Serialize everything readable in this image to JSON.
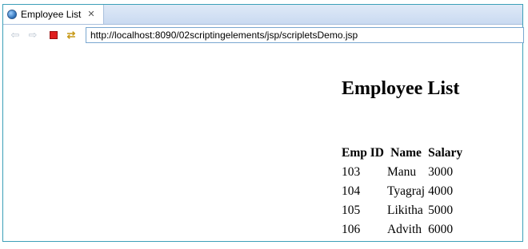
{
  "tab": {
    "title": "Employee List",
    "close_glyph": "✕",
    "icon": "globe-icon"
  },
  "toolbar": {
    "back_icon": "⇦",
    "forward_icon": "⇨",
    "refresh_icon": "⇄",
    "url": "http://localhost:8090/02scriptingelements/jsp/scripletsDemo.jsp"
  },
  "page": {
    "heading": "Employee List",
    "table": {
      "headers": [
        "Emp ID",
        "Name",
        "Salary"
      ],
      "rows": [
        [
          "103",
          "Manu",
          "3000"
        ],
        [
          "104",
          "Tyagraj",
          "4000"
        ],
        [
          "105",
          "Likitha",
          "5000"
        ],
        [
          "106",
          "Advith",
          "6000"
        ]
      ]
    }
  },
  "colors": {
    "frame_border": "#3c9fb8",
    "tabbar": "#c9daf1",
    "stop": "#e02020"
  }
}
